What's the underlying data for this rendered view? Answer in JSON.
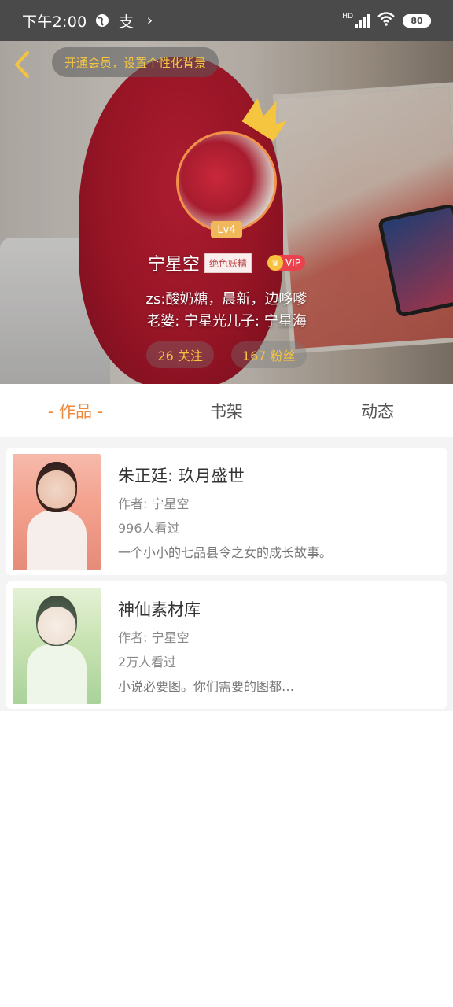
{
  "status_bar": {
    "time": "下午2:00",
    "app_icon_text": "支",
    "chevron": "›",
    "network": "HD",
    "battery": "80"
  },
  "header": {
    "vip_banner": "开通会员，设置个性化背景"
  },
  "profile": {
    "level": "Lv4",
    "name": "宁星空",
    "title_tag": "绝色妖精",
    "vip_label": "VIP",
    "bio_line1": "zs:酸奶糖，晨新，边哆嗲",
    "bio_line2": "老婆: 宁星光儿子: 宁星海",
    "following": "26 关注",
    "followers": "167 粉丝"
  },
  "tabs": [
    {
      "label": "- 作品 -",
      "active": true
    },
    {
      "label": "书架",
      "active": false
    },
    {
      "label": "动态",
      "active": false
    }
  ],
  "works": [
    {
      "title": "朱正廷: 玖月盛世",
      "author": "作者: 宁星空",
      "views": "996人看过",
      "desc": "一个小小的七品县令之女的成长故事。"
    },
    {
      "title": "神仙素材库",
      "author": "作者: 宁星空",
      "views": "2万人看过",
      "desc": "小说必要图。你们需要的图都…"
    }
  ],
  "colors": {
    "accent": "#f08a3c",
    "gold": "#f4c33f",
    "vip_red": "#e9424d"
  }
}
